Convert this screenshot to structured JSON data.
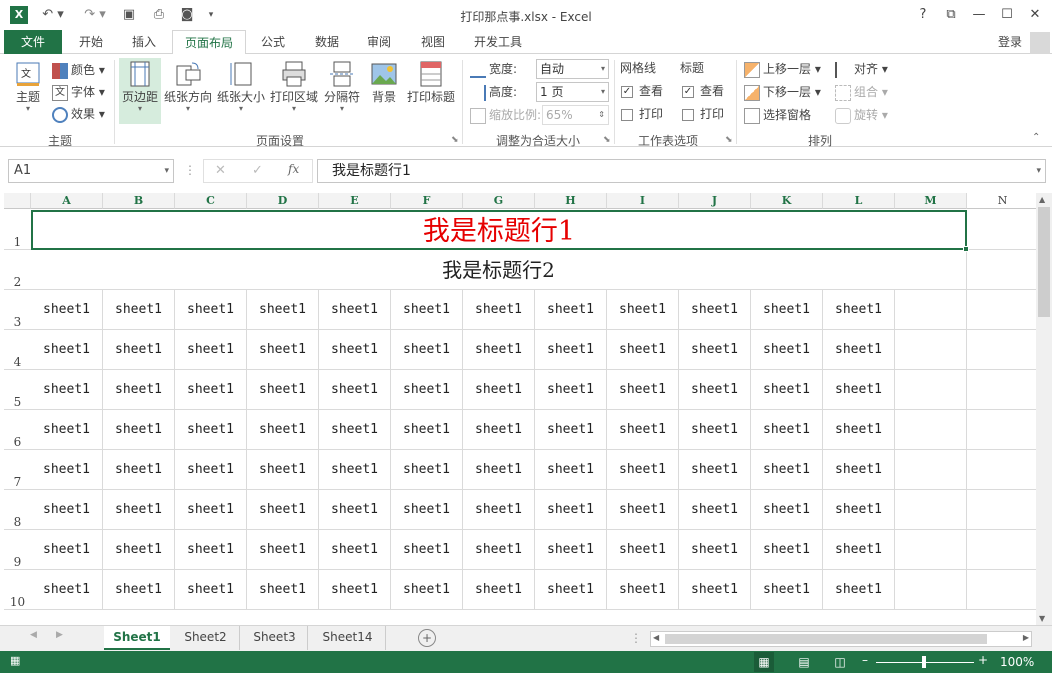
{
  "window": {
    "title": "打印那点事.xlsx - Excel",
    "help": "?",
    "login": "登录"
  },
  "tabs": [
    {
      "label": "文件"
    },
    {
      "label": "开始"
    },
    {
      "label": "插入"
    },
    {
      "label": "页面布局"
    },
    {
      "label": "公式"
    },
    {
      "label": "数据"
    },
    {
      "label": "审阅"
    },
    {
      "label": "视图"
    },
    {
      "label": "开发工具"
    }
  ],
  "ribbon": {
    "theme": {
      "group": "主题",
      "theme_btn": "主题",
      "colors": "颜色",
      "fonts": "字体",
      "effects": "效果"
    },
    "page_setup": {
      "group": "页面设置",
      "margins": "页边距",
      "orientation": "纸张方向",
      "size": "纸张大小",
      "print_area": "打印区域",
      "breaks": "分隔符",
      "background": "背景",
      "print_titles": "打印标题"
    },
    "scale": {
      "group": "调整为合适大小",
      "width_label": "宽度:",
      "width_value": "自动",
      "height_label": "高度:",
      "height_value": "1 页",
      "scale_label": "缩放比例:",
      "scale_value": "65%"
    },
    "sheet_options": {
      "group": "工作表选项",
      "gridlines": "网格线",
      "headings": "标题",
      "view": "查看",
      "print": "打印"
    },
    "arrange": {
      "group": "排列",
      "bring_forward": "上移一层",
      "send_backward": "下移一层",
      "selection_pane": "选择窗格",
      "align": "对齐",
      "group_btn": "组合",
      "rotate": "旋转"
    }
  },
  "formula": {
    "name_box": "A1",
    "content": "我是标题行1"
  },
  "columns": [
    "A",
    "B",
    "C",
    "D",
    "E",
    "F",
    "G",
    "H",
    "I",
    "J",
    "K",
    "L",
    "M",
    "N"
  ],
  "rows": [
    "1",
    "2",
    "3",
    "4",
    "5",
    "6",
    "7",
    "8",
    "9",
    "10"
  ],
  "cells": {
    "title1": "我是标题行1",
    "title2": "我是标题行2",
    "data_text": "sheet1"
  },
  "sheets": [
    {
      "label": "Sheet1"
    },
    {
      "label": "Sheet2"
    },
    {
      "label": "Sheet3"
    },
    {
      "label": "Sheet14"
    }
  ],
  "status": {
    "zoom": "100%"
  },
  "colors": {
    "accent": "#217346",
    "title_red": "#e60000"
  }
}
